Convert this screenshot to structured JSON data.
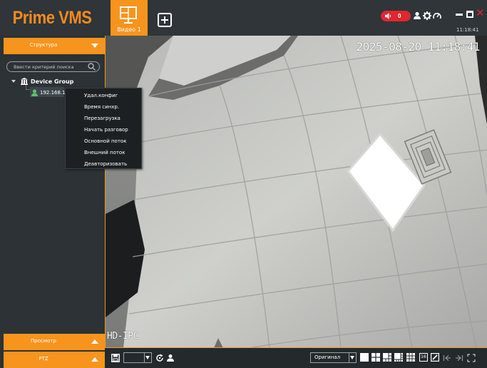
{
  "app": {
    "logo_text": "Prime VMS",
    "accent_color": "#f7941d",
    "brand_color": "#f78a1e"
  },
  "header": {
    "tabs": [
      {
        "label": "Видео 1",
        "icon": "monitor-icon"
      }
    ],
    "add_tab_icon": "plus-square-icon",
    "alarm_count": "0",
    "clock": "11:18:41",
    "icons": [
      "speaker-icon",
      "user-icon",
      "gear-icon",
      "gauge-icon",
      "minimize-icon",
      "maximize-icon",
      "close-icon"
    ]
  },
  "left_panel": {
    "structure_label": "Структура",
    "search": {
      "placeholder": "Ввести критерий поиска",
      "value": ""
    },
    "tree": {
      "group_label": "Device Group",
      "device_label": "192.168.1.1"
    },
    "view_label": "Просмотр",
    "ptz_label": "PTZ"
  },
  "context_menu": {
    "items": [
      "Удал.конфиг",
      "Время синхр.",
      "Перезагрузка",
      "Начать разговор",
      "Основной поток",
      "Внешний поток",
      "Деавторизовать"
    ]
  },
  "video": {
    "osd_timestamp": "2025-08-20 11:18:41",
    "osd_camera_name": "HD-IPC"
  },
  "toolbar": {
    "stream_value": "",
    "ratio_value": "Оригинал",
    "layout_16_label": "16",
    "icons": [
      "snapshot-icon",
      "refresh-icon",
      "talk-icon",
      "layout-1-icon",
      "layout-4-icon",
      "layout-6-icon",
      "layout-8-icon",
      "layout-9-icon",
      "layout-16-icon",
      "edit-icon",
      "prev-page-icon",
      "next-page-icon",
      "fullscreen-icon"
    ]
  }
}
